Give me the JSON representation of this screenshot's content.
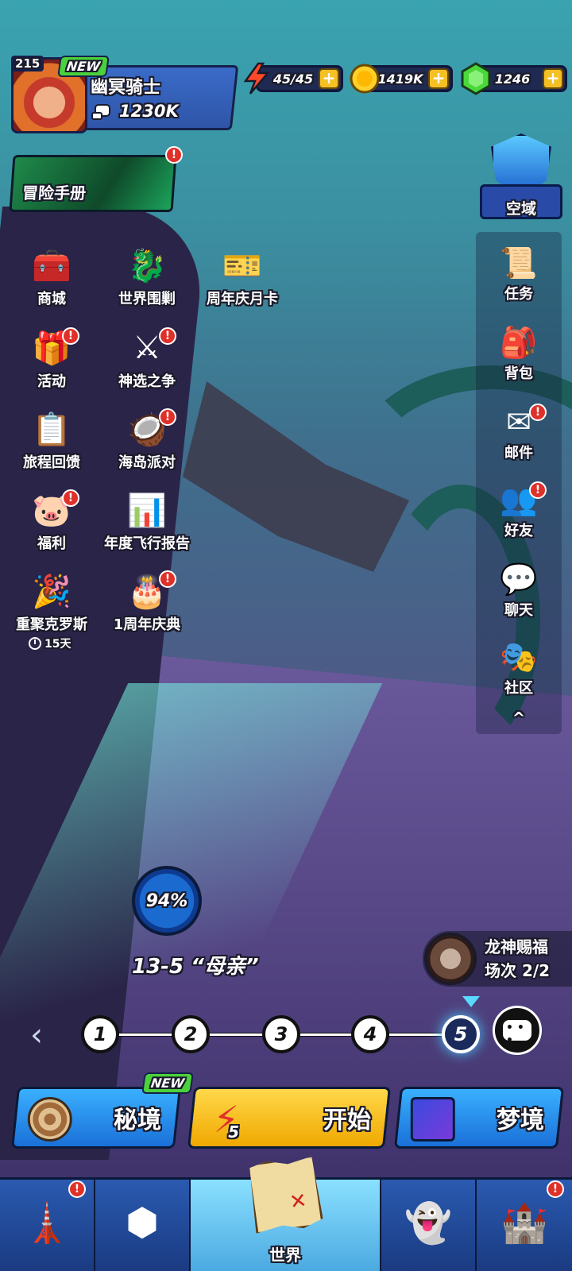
{
  "player": {
    "level": "215",
    "new_badge": "NEW",
    "name": "幽冥骑士",
    "power": "1230K"
  },
  "resources": {
    "energy": "45/45",
    "gold": "1419K",
    "gems": "1246",
    "plus": "+"
  },
  "adventure_book": {
    "label": "冒险手册"
  },
  "sky_zone": {
    "label": "空域"
  },
  "sidebar": {
    "items": [
      {
        "label": "任务",
        "icon": "scroll-icon"
      },
      {
        "label": "背包",
        "icon": "backpack-icon"
      },
      {
        "label": "邮件",
        "icon": "mail-icon"
      },
      {
        "label": "好友",
        "icon": "friends-icon"
      },
      {
        "label": "聊天",
        "icon": "chat-icon"
      },
      {
        "label": "社区",
        "icon": "community-icon"
      }
    ],
    "collapse": "^"
  },
  "features": [
    {
      "label": "商城"
    },
    {
      "label": "世界围剿"
    },
    {
      "label": "周年庆月卡"
    },
    {
      "label": "活动"
    },
    {
      "label": "神选之争"
    },
    {
      "label": "旅程回馈"
    },
    {
      "label": "海岛派对"
    },
    {
      "label": "福利"
    },
    {
      "label": "年度飞行报告"
    },
    {
      "label": "重聚克罗斯"
    },
    {
      "label": "1周年庆典"
    }
  ],
  "event_timer": "15天",
  "stage": {
    "progress": "94%",
    "title": "13-5 “母亲”",
    "steps": [
      "1",
      "2",
      "3",
      "4",
      "5"
    ],
    "active_step": 5
  },
  "dragon_blessing": {
    "title": "龙神赐福",
    "count": "场次 2/2"
  },
  "actions": {
    "secret": "秘境",
    "secret_badge": "NEW",
    "start": "开始",
    "start_cost": "5",
    "dream": "梦境"
  },
  "bottom_nav": {
    "world": "世界"
  },
  "alert": "!"
}
